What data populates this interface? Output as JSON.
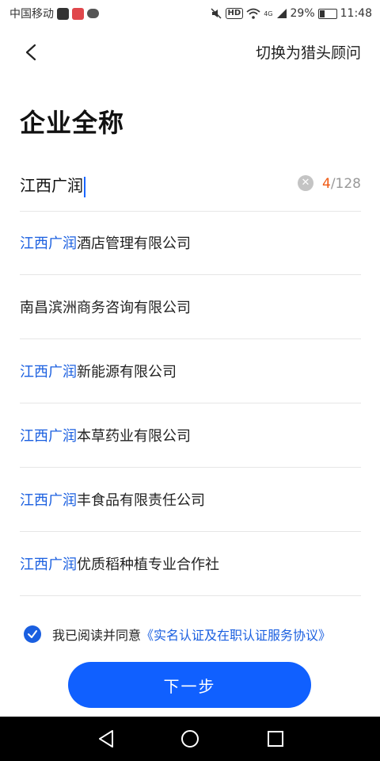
{
  "status_bar": {
    "carrier": "中国移动",
    "network": "4G",
    "battery": "29%",
    "time": "11:48"
  },
  "header": {
    "switch_label": "切换为猎头顾问"
  },
  "page": {
    "title": "企业全称"
  },
  "input": {
    "value": "江西广润",
    "count_current": "4",
    "count_max": "/128"
  },
  "suggestions": [
    {
      "highlight": "江西广润",
      "rest": "酒店管理有限公司"
    },
    {
      "highlight": "",
      "rest": "南昌滨洲商务咨询有限公司"
    },
    {
      "highlight": "江西广润",
      "rest": "新能源有限公司"
    },
    {
      "highlight": "江西广润",
      "rest": "本草药业有限公司"
    },
    {
      "highlight": "江西广润",
      "rest": "丰食品有限责任公司"
    },
    {
      "highlight": "江西广润",
      "rest": "优质稻种植专业合作社"
    }
  ],
  "agreement": {
    "checked": true,
    "text": "我已阅读并同意",
    "link": "《实名认证及在职认证服务协议》"
  },
  "footer": {
    "next_label": "下一步"
  },
  "colors": {
    "accent": "#1060ff",
    "highlight": "#1a5fe0",
    "counter": "#f05a13"
  }
}
